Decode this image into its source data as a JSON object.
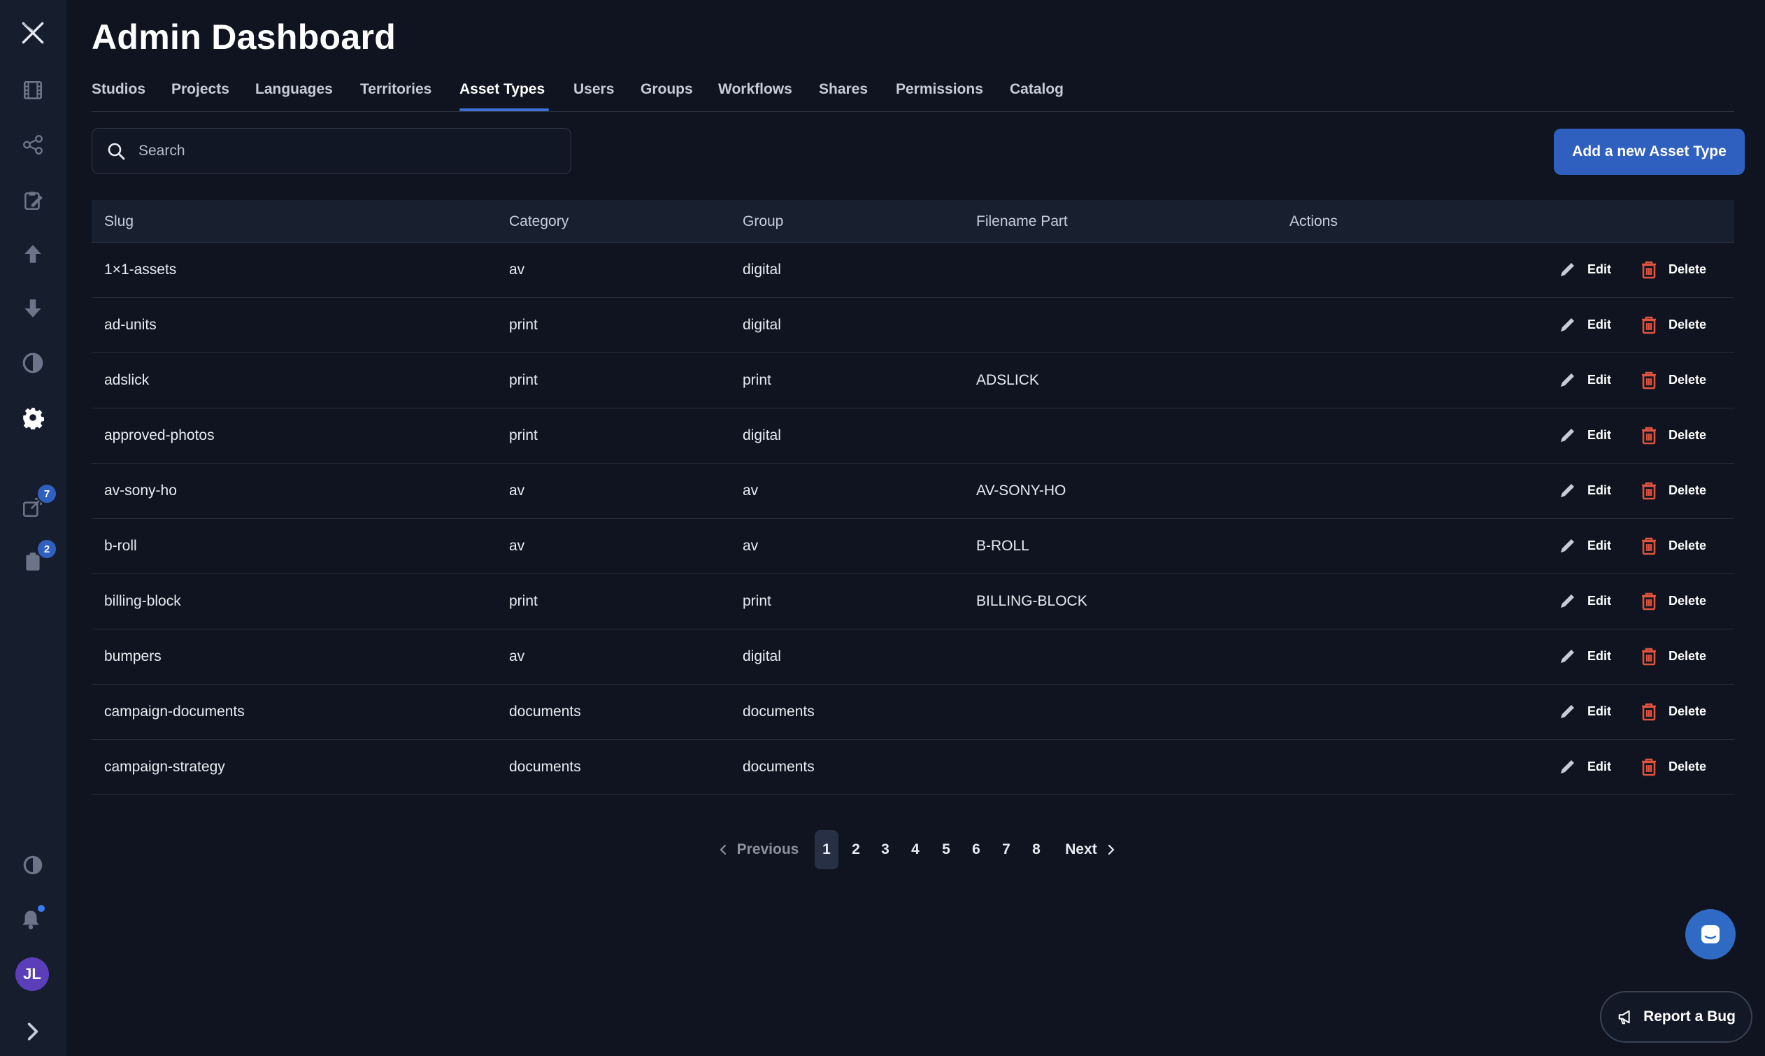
{
  "header": {
    "title": "Admin Dashboard"
  },
  "tabs": [
    {
      "label": "Studios"
    },
    {
      "label": "Projects"
    },
    {
      "label": "Languages"
    },
    {
      "label": "Territories"
    },
    {
      "label": "Asset Types"
    },
    {
      "label": "Users"
    },
    {
      "label": "Groups"
    },
    {
      "label": "Workflows"
    },
    {
      "label": "Shares"
    },
    {
      "label": "Permissions"
    },
    {
      "label": "Catalog"
    }
  ],
  "active_tab": "Asset Types",
  "search": {
    "placeholder": "Search",
    "value": ""
  },
  "toolbar": {
    "add_label": "Add a new Asset Type"
  },
  "table": {
    "columns": [
      "Slug",
      "Category",
      "Group",
      "Filename Part",
      "Actions"
    ],
    "rows": [
      {
        "slug": "1×1-assets",
        "category": "av",
        "group": "digital",
        "filename_part": ""
      },
      {
        "slug": "ad-units",
        "category": "print",
        "group": "digital",
        "filename_part": ""
      },
      {
        "slug": "adslick",
        "category": "print",
        "group": "print",
        "filename_part": "ADSLICK"
      },
      {
        "slug": "approved-photos",
        "category": "print",
        "group": "digital",
        "filename_part": ""
      },
      {
        "slug": "av-sony-ho",
        "category": "av",
        "group": "av",
        "filename_part": "AV-SONY-HO"
      },
      {
        "slug": "b-roll",
        "category": "av",
        "group": "av",
        "filename_part": "B-ROLL"
      },
      {
        "slug": "billing-block",
        "category": "print",
        "group": "print",
        "filename_part": "BILLING-BLOCK"
      },
      {
        "slug": "bumpers",
        "category": "av",
        "group": "digital",
        "filename_part": ""
      },
      {
        "slug": "campaign-documents",
        "category": "documents",
        "group": "documents",
        "filename_part": ""
      },
      {
        "slug": "campaign-strategy",
        "category": "documents",
        "group": "documents",
        "filename_part": ""
      }
    ],
    "edit_label": "Edit",
    "delete_label": "Delete"
  },
  "pagination": {
    "previous_label": "Previous",
    "next_label": "Next",
    "pages": [
      "1",
      "2",
      "3",
      "4",
      "5",
      "6",
      "7",
      "8"
    ],
    "current": "1"
  },
  "sidebar": {
    "items": [
      {
        "icon": "film-icon"
      },
      {
        "icon": "share-nodes-icon"
      },
      {
        "icon": "clipboard-edit-icon"
      },
      {
        "icon": "upload-arrow-icon"
      },
      {
        "icon": "download-arrow-icon"
      },
      {
        "icon": "half-circle-chart-icon"
      },
      {
        "icon": "gear-icon"
      },
      {
        "icon": "external-share-icon"
      },
      {
        "icon": "clipboard-icon"
      }
    ],
    "badges": {
      "shares": "7",
      "tasks": "2"
    },
    "avatar_initials": "JL"
  },
  "floating": {
    "report_bug_label": "Report a Bug"
  },
  "colors": {
    "background": "#0f1420",
    "sidebar": "#161d2c",
    "accent": "#2f5fbf",
    "delete_red": "#e0533f",
    "avatar": "#5b3fb8"
  }
}
